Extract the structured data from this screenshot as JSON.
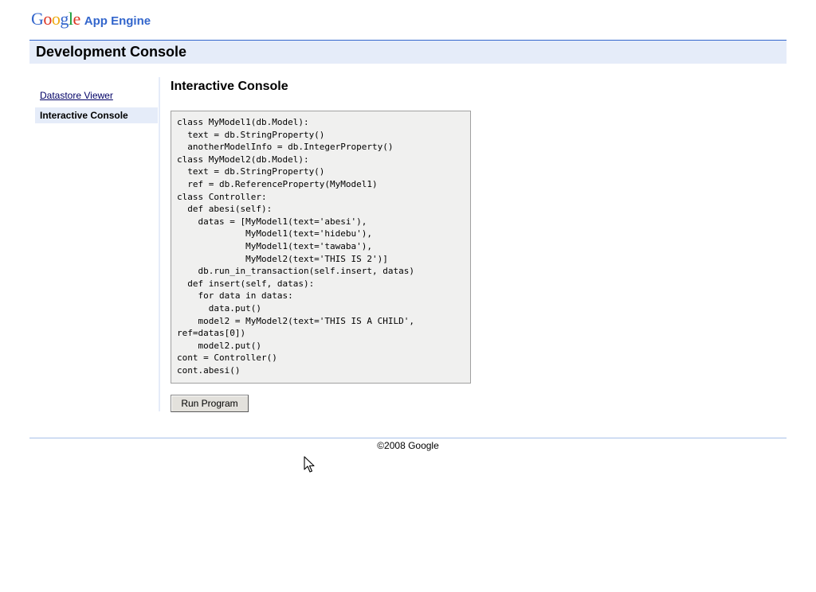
{
  "header": {
    "logo_letters": [
      {
        "char": "G",
        "color": "#3366cc"
      },
      {
        "char": "o",
        "color": "#dd3322"
      },
      {
        "char": "o",
        "color": "#eeaa11"
      },
      {
        "char": "g",
        "color": "#3366cc"
      },
      {
        "char": "l",
        "color": "#119933"
      },
      {
        "char": "e",
        "color": "#dd3322"
      }
    ],
    "product_name": "App Engine"
  },
  "title_bar": {
    "title": "Development Console"
  },
  "sidebar": {
    "items": [
      {
        "label": "Datastore Viewer",
        "selected": false
      },
      {
        "label": "Interactive Console",
        "selected": true
      }
    ]
  },
  "main": {
    "heading": "Interactive Console",
    "code": "class MyModel1(db.Model):\n  text = db.StringProperty()\n  anotherModelInfo = db.IntegerProperty()\nclass MyModel2(db.Model):\n  text = db.StringProperty()\n  ref = db.ReferenceProperty(MyModel1)\nclass Controller:\n  def abesi(self):\n    datas = [MyModel1(text='abesi'),\n             MyModel1(text='hidebu'),\n             MyModel1(text='tawaba'),\n             MyModel2(text='THIS IS 2')]\n    db.run_in_transaction(self.insert, datas)\n  def insert(self, datas):\n    for data in datas:\n      data.put()\n    model2 = MyModel2(text='THIS IS A CHILD',\nref=datas[0])\n    model2.put()\ncont = Controller()\ncont.abesi()",
    "run_button_label": "Run Program"
  },
  "footer": {
    "copyright": "©2008 Google"
  },
  "colors": {
    "accent": "#3366cc",
    "panel_background": "#e5ecf9",
    "code_background": "#f0f0ef"
  }
}
